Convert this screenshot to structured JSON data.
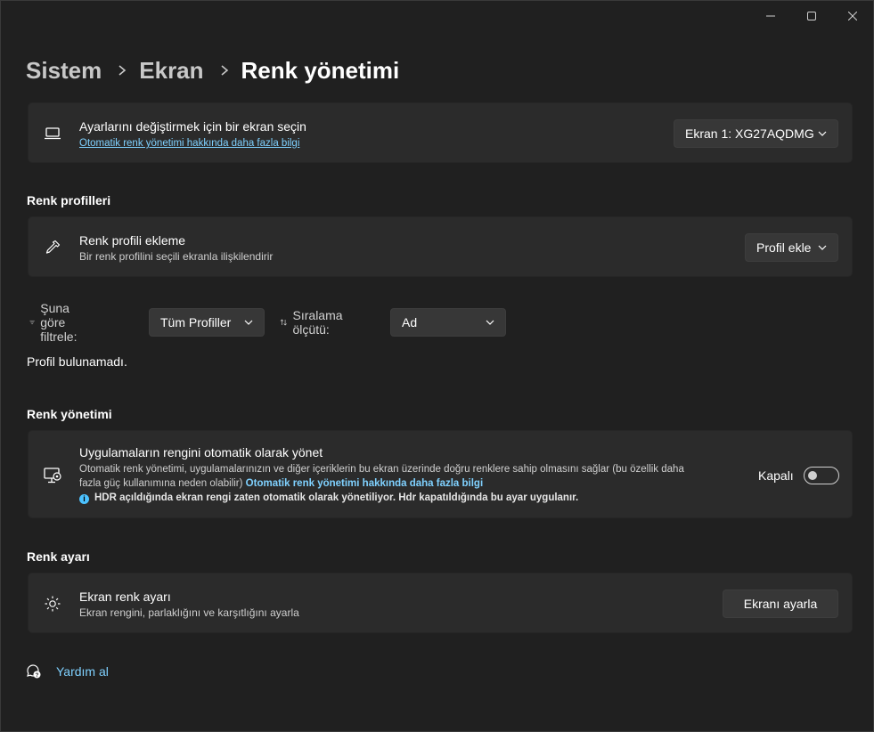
{
  "breadcrumb": {
    "items": [
      "Sistem",
      "Ekran"
    ],
    "current": "Renk yönetimi"
  },
  "display_select": {
    "title": "Ayarlarını değiştirmek için bir ekran seçin",
    "link": "Otomatik renk yönetimi hakkında daha fazla bilgi",
    "selected": "Ekran 1: XG27AQDMG"
  },
  "profiles": {
    "section_title": "Renk profilleri",
    "add_title": "Renk profili ekleme",
    "add_sub": "Bir renk profilini seçili ekranla ilişkilendirir",
    "add_button": "Profil ekle",
    "filter_label": "Şuna göre filtrele:",
    "filter_value": "Tüm Profiller",
    "sort_label": "Sıralama ölçütü:",
    "sort_value": "Ad",
    "empty_text": "Profil bulunamadı."
  },
  "management": {
    "section_title": "Renk yönetimi",
    "title": "Uygulamaların rengini otomatik olarak yönet",
    "desc_line1": "Otomatik renk yönetimi, uygulamalarınızın ve diğer içeriklerin bu ekran üzerinde doğru renklere sahip olmasını sağlar (bu özellik daha",
    "desc_line2": "fazla güç kullanımına neden olabilir)",
    "desc_link": "Otomatik renk yönetimi hakkında daha fazla bilgi",
    "info_text": "HDR açıldığında ekran rengi zaten otomatik olarak yönetiliyor. Hdr kapatıldığında bu ayar uygulanır.",
    "toggle_label": "Kapalı"
  },
  "calibration": {
    "section_title": "Renk ayarı",
    "title": "Ekran renk ayarı",
    "sub": "Ekran rengini, parlaklığını ve karşıtlığını ayarla",
    "button": "Ekranı ayarla"
  },
  "help": {
    "label": "Yardım al"
  },
  "colors": {
    "background": "#202020",
    "card": "#2b2b2b",
    "accent_link": "#7fd1ff",
    "info": "#4cc2ff"
  }
}
